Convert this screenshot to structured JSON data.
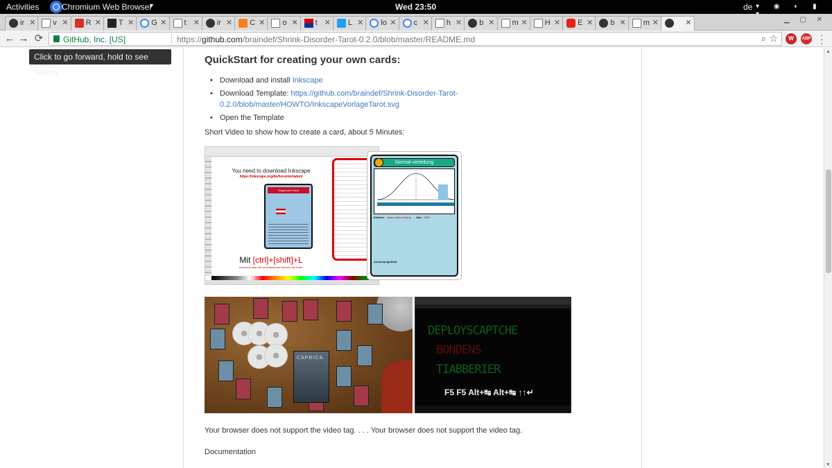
{
  "topbar": {
    "activities": "Activities",
    "app_name": "Chromium Web Browser",
    "clock": "Wed 23:50",
    "keyboard_layout": "de"
  },
  "tabs": [
    {
      "label": "ir",
      "icon": "github-icon"
    },
    {
      "label": "v",
      "icon": "document-icon"
    },
    {
      "label": "R",
      "icon": "red-icon"
    },
    {
      "label": "T",
      "icon": "dark-icon"
    },
    {
      "label": "G",
      "icon": "google-icon"
    },
    {
      "label": "t",
      "icon": "document-icon"
    },
    {
      "label": "ir",
      "icon": "github-icon"
    },
    {
      "label": "C",
      "icon": "orange-icon"
    },
    {
      "label": "o",
      "icon": "document-icon"
    },
    {
      "label": "t",
      "icon": "flag-icon"
    },
    {
      "label": "L",
      "icon": "twitter-icon"
    },
    {
      "label": "lo",
      "icon": "google-icon"
    },
    {
      "label": "c",
      "icon": "google-icon"
    },
    {
      "label": "h",
      "icon": "document-icon"
    },
    {
      "label": "b",
      "icon": "github-icon"
    },
    {
      "label": "m",
      "icon": "document-icon"
    },
    {
      "label": "H",
      "icon": "document-icon"
    },
    {
      "label": "E",
      "icon": "youtube-icon"
    },
    {
      "label": "b",
      "icon": "github-icon"
    },
    {
      "label": "m",
      "icon": "document-icon"
    },
    {
      "label": "",
      "icon": "github-icon",
      "active": true
    }
  ],
  "toolbar": {
    "back_icon": "arrow-left-icon",
    "forward_icon": "arrow-right-icon",
    "reload_icon": "reload-icon",
    "ev_label": "GitHub, Inc. [US]",
    "url_scheme": "https://",
    "url_host": "github.com",
    "url_path": "/braindef/Shrink-Disorder-Tarot-0.2.0/blob/master/README.md",
    "ext1": "W",
    "ext2": "ABP"
  },
  "tooltip": "Click to go forward, hold to see history",
  "article": {
    "heading": "QuickStart for creating your own cards:",
    "items": [
      {
        "text": "Download and install ",
        "link": "Inkscape"
      },
      {
        "text": "Download Template: ",
        "link1": "https://github.com/braindef/Shrink-Disorder-Tarot-",
        "link2": "0.2.0/blob/master/HOWTO/InkscapeVorlageTarot.svg"
      },
      {
        "text": "Open the Template"
      }
    ],
    "video_intro": "Short Video to show how to create a card, about 5 Minutes:",
    "inkscape_title": "You need to download Inkscape",
    "inkscape_url": "https://inkscape.org/de/herunterladen/",
    "inkscape_card_name": "Siegmund Freud",
    "inkscape_hint_prefix": "Mit ",
    "inkscape_hint_keys": "[ctrl]+[shift]+L",
    "inkscape_hint_small": "bekommt man die verschiedenen Ebenen der Karte",
    "card_title": "Normal-verteilung",
    "card_row_left": "Erfinder",
    "card_row_name": "James Alfred Ewing",
    "card_row_year_label": "Jahr",
    "card_row_year": "~1890",
    "card_notes": "Anmerkungsfelde",
    "photo_card_label": "CAPRICA",
    "term_line1": "DEPLOYSCAPTCHE",
    "term_line2": "BONDENS",
    "term_line3": "TIABBERIER",
    "term_keys": "F5 F5 Alt+↹  Alt+↹  ↑↑↵",
    "video_fallback": "Your browser does not support the video tag. . . . Your browser does not support the video tag.",
    "doc_link": "Documentation"
  }
}
